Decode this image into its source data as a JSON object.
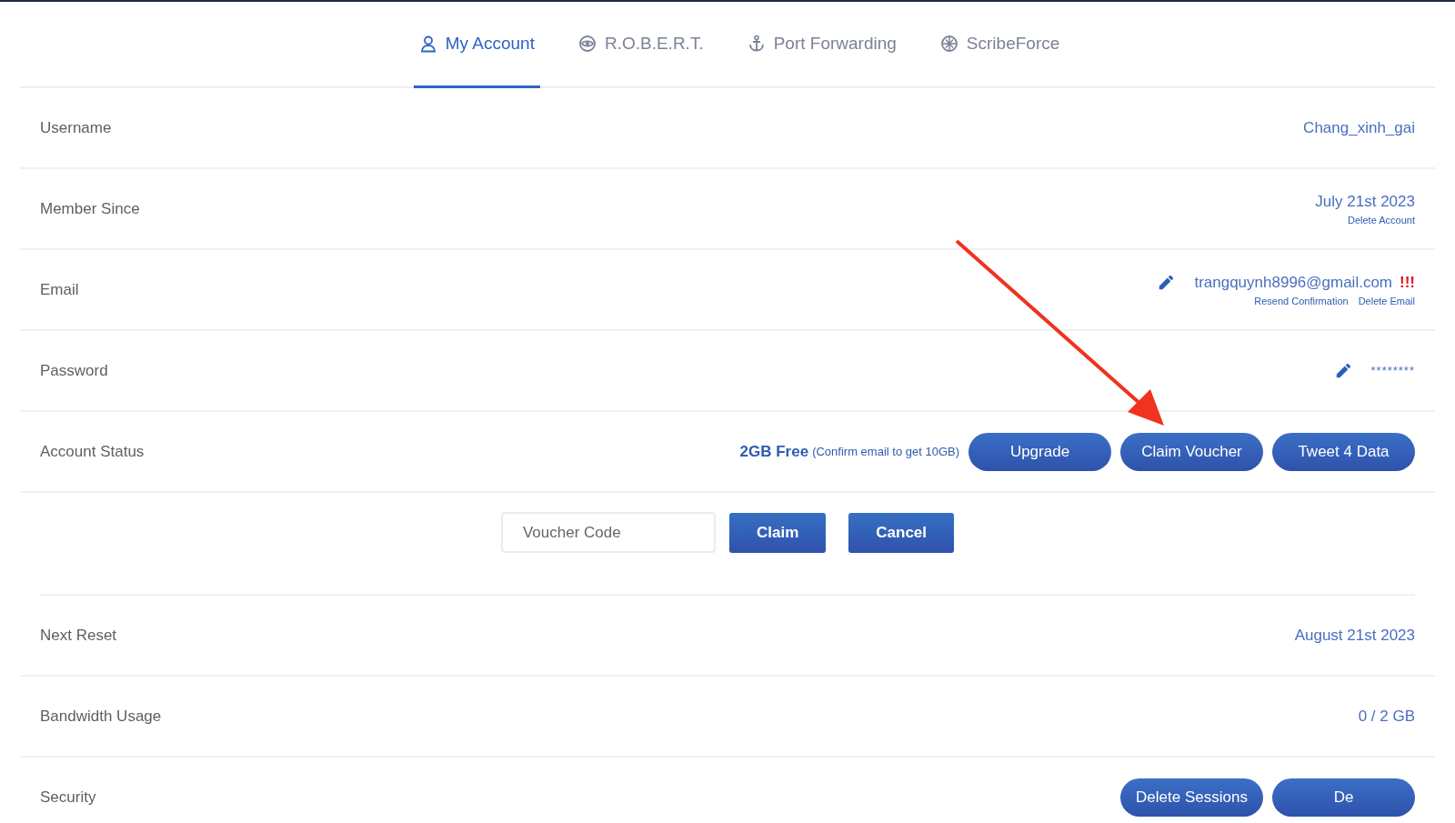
{
  "tabs": [
    {
      "label": "My Account",
      "selected": true
    },
    {
      "label": "R.O.B.E.R.T.",
      "selected": false
    },
    {
      "label": "Port Forwarding",
      "selected": false
    },
    {
      "label": "ScribeForce",
      "selected": false
    }
  ],
  "rows": [
    {
      "kind": "text",
      "label": "Username",
      "value": "Chang_xinh_gai"
    },
    {
      "kind": "text",
      "label": "Member Since",
      "value": "July 21st 2023",
      "links": [
        "Delete Account"
      ]
    },
    {
      "kind": "text",
      "label": "Email",
      "value": "trangquynh8996@gmail.com",
      "editable": true,
      "warning": "!!!",
      "links": [
        "Resend Confirmation",
        "Delete Email"
      ]
    },
    {
      "kind": "text",
      "label": "Password",
      "value": "********",
      "editable": true
    },
    {
      "kind": "status",
      "label": "Account Status",
      "plan": "2GB Free",
      "note": "(Confirm email to get 10GB)",
      "buttons": [
        "Upgrade",
        "Claim Voucher",
        "Tweet 4 Data"
      ]
    },
    {
      "kind": "voucher",
      "placeholder": "Voucher Code",
      "buttons": [
        "Claim",
        "Cancel"
      ]
    },
    {
      "kind": "text",
      "label": "Next Reset",
      "value": "August 21st 2023"
    },
    {
      "kind": "text",
      "label": "Bandwidth Usage",
      "value": "0 / 2 GB"
    },
    {
      "kind": "status",
      "label": "Security",
      "buttons": [
        "Delete Sessions",
        "De"
      ]
    }
  ],
  "annotation": {
    "kind": "arrow"
  }
}
